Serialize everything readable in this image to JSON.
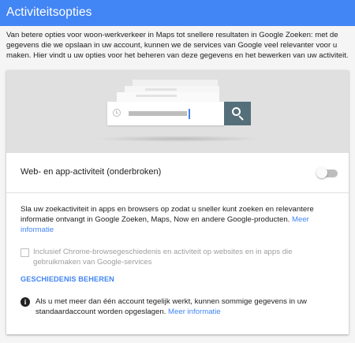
{
  "header": {
    "title": "Activiteitsopties",
    "background": "#4285f4"
  },
  "intro": {
    "text": "Van betere opties voor woon-werkverkeer in Maps tot snellere resultaten in Google Zoeken: met de gegevens die we opslaan in uw account, kunnen we de services van Google veel relevanter voor u maken. Hier vindt u uw opties voor het beheren van deze gegevens en het bewerken van uw activiteit."
  },
  "hero": {
    "icons": [
      "clock-icon",
      "search-icon"
    ]
  },
  "activity": {
    "label": "Web- en app-activiteit (onderbroken)",
    "enabled": false,
    "description": "Sla uw zoekactiviteit in apps en browsers op zodat u sneller kunt zoeken en relevantere informatie ontvangt in Google Zoeken, Maps, Now en andere Google-producten.",
    "more_link": "Meer informatie",
    "checkbox_label": "Inclusief Chrome-browsegeschiedenis en activiteit op websites en in apps die gebruikmaken van Google-services",
    "checkbox_checked": false,
    "manage_button": "GESCHIEDENIS BEHEREN"
  },
  "notice": {
    "icon": "info-icon",
    "text": "Als u met meer dan één account tegelijk werkt, kunnen sommige gegevens in uw standaardaccount worden opgeslagen.",
    "more_link": "Meer informatie"
  },
  "colors": {
    "accent": "#4285f4",
    "search_button": "#546e7a"
  }
}
